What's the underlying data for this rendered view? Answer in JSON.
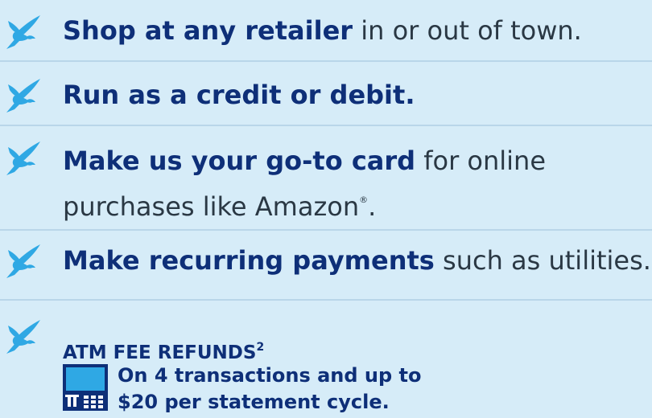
{
  "items": [
    {
      "bold": "Shop at any retailer",
      "rest": " in or out of town."
    },
    {
      "bold": "Run as a credit or debit.",
      "rest": ""
    },
    {
      "bold": "Make us your go-to card",
      "rest": " for online"
    },
    {
      "bold": "Make recurring payments",
      "rest": " such as utilities."
    }
  ],
  "item3_line2": {
    "text": "purchases like Amazon",
    "mark": "®",
    "end": "."
  },
  "atm": {
    "title": "ATM FEE REFUNDS",
    "footnote": "2",
    "line1": "On 4 transactions and up to",
    "line2": "$20 per statement cycle."
  },
  "icons": {
    "bullet": "bird-icon",
    "atm": "atm-machine-icon"
  },
  "colors": {
    "background": "#d6ecf8",
    "heading": "#0e2f78",
    "body_text": "#2a3844",
    "bird": "#2fa8e4",
    "divider": "#b9d6e9"
  }
}
